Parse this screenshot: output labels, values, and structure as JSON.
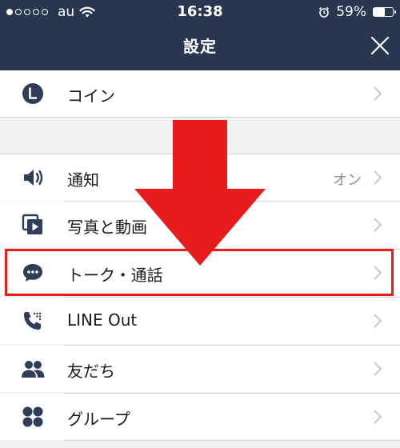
{
  "status_bar": {
    "carrier": "au",
    "time": "16:38",
    "battery": "59%",
    "battery_level": 0.59,
    "signal_bars_filled": 1,
    "signal_bars_total": 5
  },
  "header": {
    "title": "設定",
    "close_icon": "close-icon"
  },
  "items": [
    {
      "label": "コイン",
      "icon": "coin-icon",
      "value": ""
    },
    {
      "label": "通知",
      "icon": "speaker-icon",
      "value": "オン"
    },
    {
      "label": "写真と動画",
      "icon": "photo-video-icon",
      "value": ""
    },
    {
      "label": "トーク・通話",
      "icon": "chat-bubble-icon",
      "value": ""
    },
    {
      "label": "LINE Out",
      "icon": "phone-icon",
      "value": ""
    },
    {
      "label": "友だち",
      "icon": "friends-icon",
      "value": ""
    },
    {
      "label": "グループ",
      "icon": "group-icon",
      "value": ""
    }
  ],
  "annotation": {
    "highlighted_item": "トーク・通話",
    "color": "#e81c1c"
  },
  "colors": {
    "header_bg": "#283650",
    "icon": "#2f3d59",
    "highlight": "#e81c1c"
  }
}
